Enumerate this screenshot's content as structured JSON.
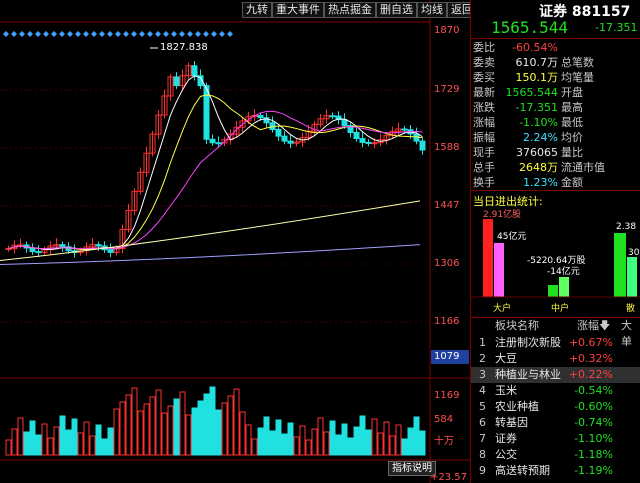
{
  "toolbar": {
    "items": [
      "九转",
      "重大事件",
      "热点掘金",
      "删自选",
      "均线",
      "返回"
    ]
  },
  "chart": {
    "high_label": "1827.838",
    "price_axis": [
      "1870",
      "1729",
      "1588",
      "1447",
      "1306",
      "1166"
    ],
    "current_price_tag": "1079",
    "volume_axis": [
      "1169",
      "584",
      "十万"
    ],
    "bottom_label": "+23.57亿",
    "indicator_button": "指标说明"
  },
  "header": {
    "title": "证券 881157",
    "price": "1565.544",
    "change": "-17.351"
  },
  "quotes": [
    {
      "label": "委比",
      "value": "-60.54%",
      "color": "red"
    },
    {
      "label": "委卖",
      "value": "610.7万",
      "label2": "总笔数",
      "color": "white"
    },
    {
      "label": "委买",
      "value": "150.1万",
      "label2": "均笔量",
      "color": "yellow"
    },
    {
      "label": "最新",
      "value": "1565.544",
      "label2": "开盘",
      "color": "green"
    },
    {
      "label": "涨跌",
      "value": "-17.351",
      "label2": "最高",
      "color": "green"
    },
    {
      "label": "涨幅",
      "value": "-1.10%",
      "label2": "最低",
      "color": "green"
    },
    {
      "label": "振幅",
      "value": "2.24%",
      "label2": "均价",
      "color": "cyan"
    },
    {
      "label": "现手",
      "value": "376065",
      "label2": "量比",
      "color": "white"
    },
    {
      "label": "总手",
      "value": "2648万",
      "label2": "流通市值",
      "color": "yellow"
    },
    {
      "label": "换手",
      "value": "1.23%",
      "label2": "金额",
      "color": "cyan"
    }
  ],
  "flow": {
    "title": "当日进出统计:",
    "big_in": "2.91亿股",
    "big_out": "45亿元",
    "mid_in": "-5220.64万股",
    "mid_out": "-14亿元",
    "small_in": "2.38",
    "small_out": "30",
    "labels": [
      "大户",
      "中户",
      "散"
    ]
  },
  "sectors": {
    "header": {
      "name": "板块名称",
      "change": "涨幅",
      "next": "大单"
    },
    "rows": [
      {
        "n": "1",
        "name": "注册制次新股",
        "pct": "+0.67%",
        "color": "red"
      },
      {
        "n": "2",
        "name": "大豆",
        "pct": "+0.32%",
        "color": "red"
      },
      {
        "n": "3",
        "name": "种植业与林业",
        "pct": "+0.22%",
        "color": "red"
      },
      {
        "n": "4",
        "name": "玉米",
        "pct": "-0.54%",
        "color": "green"
      },
      {
        "n": "5",
        "name": "农业种植",
        "pct": "-0.60%",
        "color": "green"
      },
      {
        "n": "6",
        "name": "转基因",
        "pct": "-0.74%",
        "color": "green"
      },
      {
        "n": "7",
        "name": "证券",
        "pct": "-1.10%",
        "color": "green"
      },
      {
        "n": "8",
        "name": "公交",
        "pct": "-1.18%",
        "color": "green"
      },
      {
        "n": "9",
        "name": "高送转预期",
        "pct": "-1.19%",
        "color": "green"
      }
    ]
  },
  "colors": {
    "up": "#ff3030",
    "down": "#20e0e0",
    "ma5": "#ffffff",
    "ma10": "#ffff40",
    "ma20": "#ff40ff",
    "ma60": "#ffffb0",
    "ma120": "#a0a0ff"
  }
}
